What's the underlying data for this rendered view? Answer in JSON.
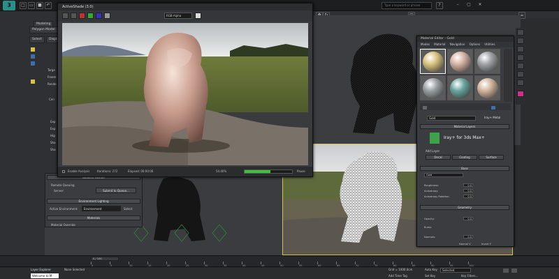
{
  "titlebar": {
    "app_name": "3ds Max",
    "search_placeholder": "Type a keyword or phrase",
    "logo_text": "3"
  },
  "command_panel": {
    "ribbon_tabs": [
      "Modeling",
      "Polygon Model"
    ],
    "sub_tabs": [
      "Select",
      "Display"
    ],
    "partial_labels": [
      "Targe",
      "Freem",
      "Rende",
      "Exp",
      "Exp",
      "Hig",
      "Sha",
      "Sha",
      "Cen"
    ]
  },
  "render_window": {
    "title": "ActiveShade (3.0)",
    "display_mode": "RGB Alpha",
    "status": {
      "enable_analysis_label": "Enable Analysis",
      "iterations_label": "Iterations: 272",
      "elapsed_label": "Elapsed: 00:00:06",
      "percent_text": "54.40%",
      "progress": 0.544,
      "pause_label": "Pause"
    }
  },
  "settings_panel": {
    "rollup_network": "Network Render",
    "remote_queuing": "Remote Queuing",
    "server_label": "Server:",
    "submit_button": "Submit to Queue...",
    "rollup_env": "Environment Lighting",
    "active_env_label": "Active Environment:",
    "active_env_value": "Environment",
    "select_button": "Select",
    "rollup_materials": "Materials",
    "material_overrides": "Material Override"
  },
  "material_editor": {
    "title": "Material Editor - Gold",
    "menu": [
      "Modes",
      "Material",
      "Navigation",
      "Options",
      "Utilities"
    ],
    "slots": [
      "#d8c37e",
      "#d7b3a4",
      "#9fa1a6",
      "#9aa0a3",
      "#6aa59d",
      "#d2b59c"
    ],
    "material_name": "Gold",
    "material_type": "Iray+ Metal",
    "layers_rollup": "Material Layers",
    "iray_brand": "Iray+ for 3ds Max+",
    "add_layer": "Add Layer",
    "layer_buttons": [
      "Decal",
      "Coating",
      "Surface"
    ],
    "base_rollup": "Base",
    "base_preset": "Gold",
    "params": [
      {
        "label": "Roughness:",
        "value": "0.0"
      },
      {
        "label": "Anisotropy:",
        "value": "0.0"
      },
      {
        "label": "Anisotropy Rotation:",
        "value": "0.0"
      }
    ],
    "geometry_rollup": "Geometry",
    "opacity_label": "Opacity:",
    "opacity_value": "0.0",
    "bump_label": "Bump",
    "normals_label": "Normals:",
    "normals_value": "0.0",
    "bottom_labels": [
      "Normal V",
      "Invert Y"
    ]
  },
  "timeline": {
    "frame_readout": "0 / 100",
    "ticks": [
      "0",
      "5",
      "10",
      "15",
      "20",
      "25",
      "30",
      "35",
      "40",
      "45",
      "50",
      "55",
      "60",
      "65",
      "70",
      "75",
      "80",
      "85",
      "90",
      "95",
      "100"
    ]
  },
  "statusbar": {
    "layer_explorer": "Layer Explorer",
    "selection": "None Selected",
    "script_prompt": "Welcome to M",
    "grid": "Grid = 1000.0cm",
    "add_time_tag": "Add Time Tag",
    "auto_key": "Auto Key",
    "set_key": "Set Key",
    "key_mode": "Selected",
    "key_filters": "Key Filters..."
  },
  "colors": {
    "progress_green": "#3fc13f",
    "iray_green": "#3ea24a",
    "material_gold": "#d8c37e",
    "selection_yellow": "#d7c34a"
  }
}
